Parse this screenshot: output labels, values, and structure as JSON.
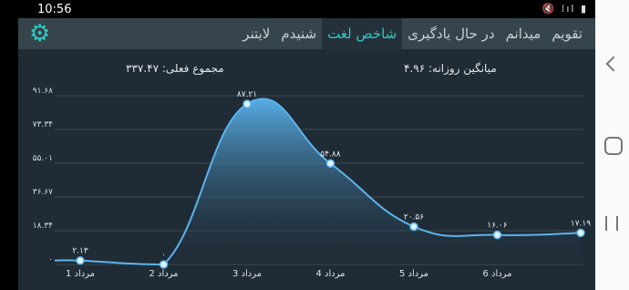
{
  "status_bar": {
    "time": "10:56",
    "icons_text": "🔇 ⁞ıl ▮"
  },
  "app": {
    "tabs": [
      {
        "label": "تقویم",
        "active": false
      },
      {
        "label": "میدانم",
        "active": false
      },
      {
        "label": "در حال یادگیری",
        "active": false
      },
      {
        "label": "شاخص لغت",
        "active": true
      },
      {
        "label": "شنیدم",
        "active": false
      },
      {
        "label": "لایتنر",
        "active": false
      }
    ],
    "accent_color": "#2ec9c4"
  },
  "summary": {
    "total_actual": "مجموع فعلی: ۳۳۷.۴۷",
    "daily_average": "میانگین روزانه: ۴.۹۶"
  },
  "chart_data": {
    "type": "area",
    "categories": [
      "",
      "1 مرداد",
      "2 مرداد",
      "3 مرداد",
      "4 مرداد",
      "5 مرداد",
      "6 مرداد",
      ""
    ],
    "values": [
      null,
      2.13,
      0,
      87.21,
      54.88,
      20.56,
      16.06,
      17.19
    ],
    "point_labels": [
      "",
      "۲.۱۳",
      "۰",
      "۸۷.۲۱",
      "۵۴.۸۸",
      "۲۰.۵۶",
      "۱۶.۰۶",
      "۱۷.۱۹"
    ],
    "y_ticks": [
      0,
      18.34,
      36.67,
      55.01,
      73.34,
      91.68
    ],
    "y_tick_labels": [
      "۰",
      "۱۸.۳۴",
      "۳۶.۶۷",
      "۵۵.۰۱",
      "۷۳.۳۴",
      "۹۱.۶۸"
    ],
    "ylim": [
      0,
      91.68
    ],
    "xlabel": "",
    "ylabel": "",
    "grid": true,
    "line_color": "#5ab4ee",
    "fill_top_color": "#5ab4ee",
    "fill_bottom_color": "#1f2b35"
  }
}
